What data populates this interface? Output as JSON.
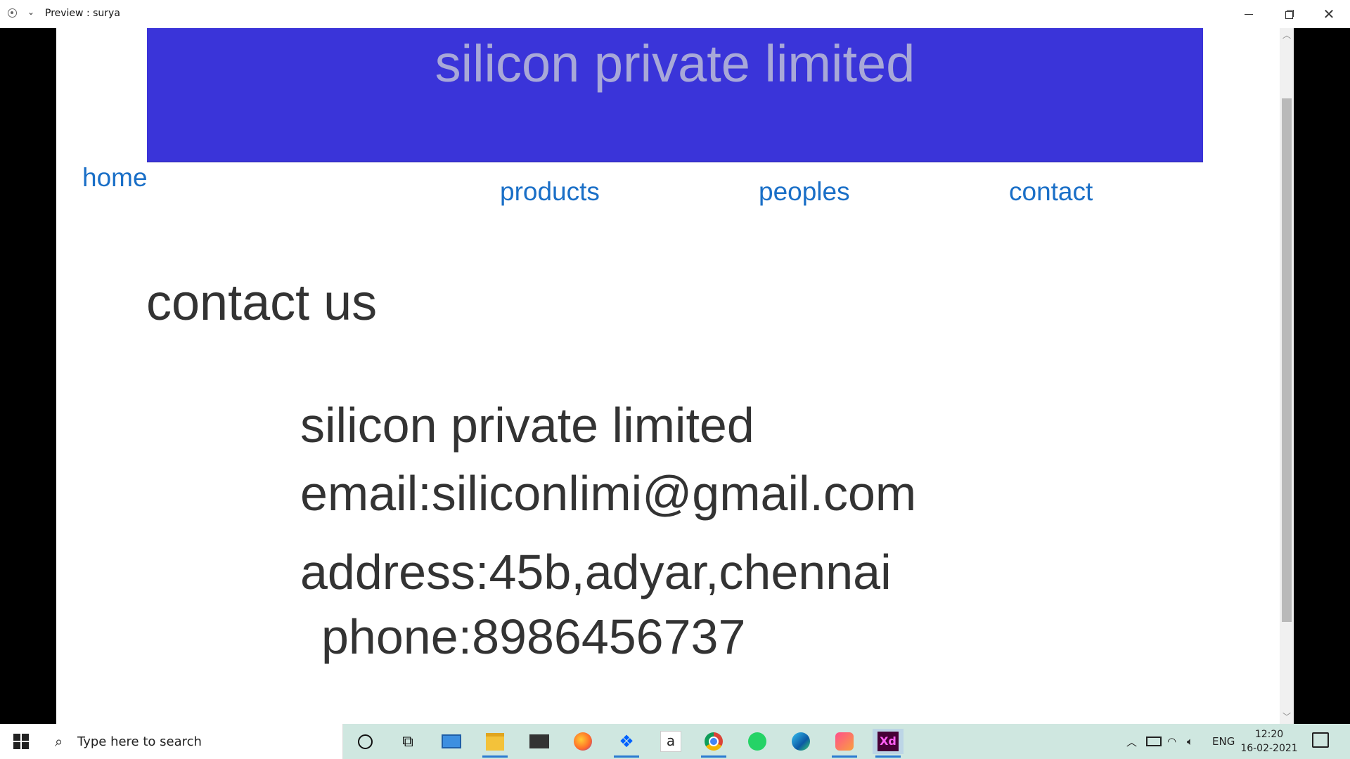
{
  "window": {
    "title": "Preview : surya"
  },
  "site": {
    "title": "silicon private limited",
    "banner_color": "#3a34d9",
    "nav": {
      "home": "home",
      "products": "products",
      "peoples": "peoples",
      "contact": "contact"
    },
    "contact_heading": "contact us",
    "company": "silicon private limited",
    "email": "email:siliconlimi@gmail.com",
    "address": "address:45b,adyar,chennai",
    "phone": "phone:8986456737"
  },
  "taskbar": {
    "search_placeholder": "Type here to search",
    "apps": [
      "cortana-icon",
      "task-view-icon",
      "computer-icon",
      "file-explorer-icon",
      "mail-icon",
      "firefox-icon",
      "dropbox-icon",
      "amazon-icon",
      "chrome-icon",
      "whatsapp-icon",
      "edge-icon",
      "creative-cloud-icon",
      "adobe-xd-icon"
    ],
    "xd_label": "Xd",
    "amazon_label": "a",
    "language": "ENG",
    "time": "12:20",
    "date": "16-02-2021"
  }
}
